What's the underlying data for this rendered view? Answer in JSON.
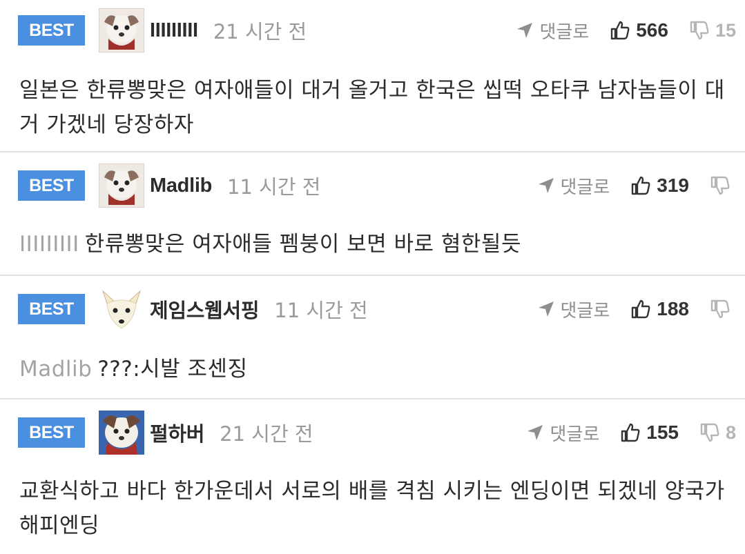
{
  "comments": [
    {
      "badge": "BEST",
      "username": "IIIIIIIII",
      "time": "21 시간 전",
      "reply_label": "댓글로",
      "likes": "566",
      "dislikes": "15",
      "mention": "",
      "text": "일본은 한류뽕맞은 여자애들이 대거 올거고 한국은 씹떡 오타쿠 남자놈들이 대거 가겠네 당장하자"
    },
    {
      "badge": "BEST",
      "username": "Madlib",
      "time": "11 시간 전",
      "reply_label": "댓글로",
      "likes": "319",
      "dislikes": "",
      "mention": "IIIIIIIII",
      "text": "한류뽕맞은 여자애들 펨붕이 보면 바로 혐한될듯"
    },
    {
      "badge": "BEST",
      "username": "제임스웹서핑",
      "time": "11 시간 전",
      "reply_label": "댓글로",
      "likes": "188",
      "dislikes": "",
      "mention": "Madlib",
      "text": "???:시발 조센징"
    },
    {
      "badge": "BEST",
      "username": "펄하버",
      "time": "21 시간 전",
      "reply_label": "댓글로",
      "likes": "155",
      "dislikes": "8",
      "mention": "",
      "text": "교환식하고 바다 한가운데서 서로의 배를 격침 시키는 엔딩이면 되겠네 양국가 해피엔딩"
    }
  ],
  "icons": {
    "reply": "reply-arrow-icon",
    "like": "thumbs-up-icon",
    "dislike": "thumbs-down-icon"
  },
  "colors": {
    "badge": "#4a8fe0",
    "divider": "#e3e3e3",
    "muted": "#9a9a9a"
  }
}
